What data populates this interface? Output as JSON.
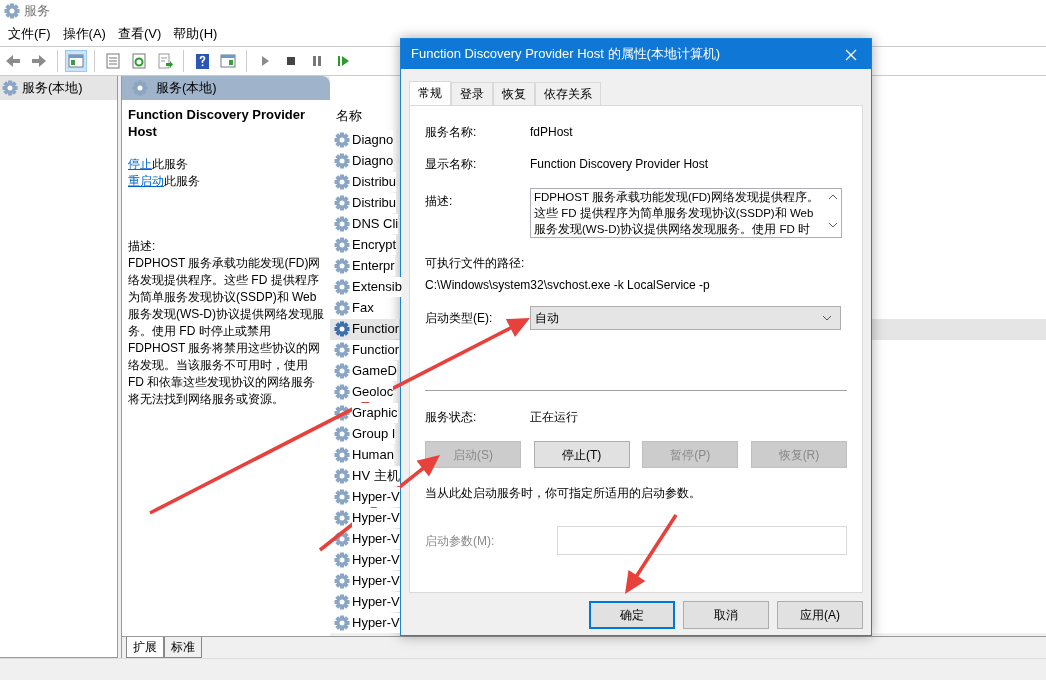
{
  "window": {
    "title": "服务"
  },
  "menu": [
    "文件(F)",
    "操作(A)",
    "查看(V)",
    "帮助(H)"
  ],
  "tree": [
    {
      "label": "服务(本地)",
      "selected": true
    }
  ],
  "panel": {
    "title": "服务(本地)",
    "service_name": "Function Discovery Provider Host",
    "actions": [
      {
        "link": "停止",
        "text": "此服务"
      },
      {
        "link": "重启动",
        "text": "此服务"
      }
    ],
    "description_label": "描述:",
    "description": "FDPHOST 服务承载功能发现(FD)网络发现提供程序。这些 FD 提供程序为简单服务发现协议(SSDP)和 Web 服务发现(WS-D)协议提供网络发现服务。使用 FD 时停止或禁用 FDPHOST 服务将禁用这些协议的网络发现。当该服务不可用时，使用 FD 和依靠这些发现协议的网络服务将无法找到网络服务或资源。"
  },
  "services": {
    "column": "名称",
    "rows": [
      {
        "name": "Diagno",
        "selected": false
      },
      {
        "name": "Diagno",
        "selected": false
      },
      {
        "name": "Distribu",
        "selected": false
      },
      {
        "name": "Distribu",
        "selected": false
      },
      {
        "name": "DNS Cli",
        "selected": false
      },
      {
        "name": "Encrypt",
        "selected": false
      },
      {
        "name": "Enterpr",
        "selected": false
      },
      {
        "name": "Extensib",
        "selected": false
      },
      {
        "name": "Fax",
        "selected": false
      },
      {
        "name": "Functior",
        "selected": true
      },
      {
        "name": "Functior",
        "selected": false
      },
      {
        "name": "GameD",
        "selected": false
      },
      {
        "name": "Geoloc",
        "selected": false
      },
      {
        "name": "Graphic",
        "selected": false
      },
      {
        "name": "Group I",
        "selected": false
      },
      {
        "name": "Human",
        "selected": false
      },
      {
        "name": "HV 主机",
        "selected": false
      },
      {
        "name": "Hyper-V",
        "selected": false
      },
      {
        "name": "Hyper-V",
        "selected": false
      },
      {
        "name": "Hyper-V",
        "selected": false
      },
      {
        "name": "Hyper-V",
        "selected": false
      },
      {
        "name": "Hyper-V",
        "selected": false
      },
      {
        "name": "Hyper-V",
        "selected": false
      },
      {
        "name": "Hyper-V",
        "selected": false
      }
    ]
  },
  "bottom_tabs": [
    {
      "label": "扩展",
      "selected": true
    },
    {
      "label": "标准",
      "selected": false
    }
  ],
  "dialog": {
    "title": "Function Discovery Provider Host 的属性(本地计算机)",
    "tabs": [
      {
        "label": "常规",
        "selected": true
      },
      {
        "label": "登录",
        "selected": false
      },
      {
        "label": "恢复",
        "selected": false
      },
      {
        "label": "依存关系",
        "selected": false
      }
    ],
    "fields": [
      {
        "label": "服务名称:",
        "value": "fdPHost"
      },
      {
        "label": "显示名称:",
        "value": "Function Discovery Provider Host"
      }
    ],
    "description_label": "描述:",
    "description": "FDPHOST 服务承载功能发现(FD)网络发现提供程序。这些 FD 提供程序为简单服务发现协议(SSDP)和 Web 服务发现(WS-D)协议提供网络发现服务。使用 FD 时",
    "path_label": "可执行文件的路径:",
    "path": "C:\\Windows\\system32\\svchost.exe -k LocalService -p",
    "startup_label": "启动类型(E):",
    "startup_value": "自动",
    "status_label": "服务状态:",
    "status": "正在运行",
    "service_buttons": [
      {
        "label": "启动(S)",
        "disabled": true
      },
      {
        "label": "停止(T)",
        "disabled": false
      },
      {
        "label": "暂停(P)",
        "disabled": true
      },
      {
        "label": "恢复(R)",
        "disabled": true
      }
    ],
    "note": "当从此处启动服务时，你可指定所适用的启动参数。",
    "params_label": "启动参数(M):",
    "params_disabled": true,
    "footer_buttons": [
      {
        "label": "确定",
        "default": true
      },
      {
        "label": "取消",
        "default": false
      },
      {
        "label": "应用(A)",
        "default": false
      }
    ]
  }
}
